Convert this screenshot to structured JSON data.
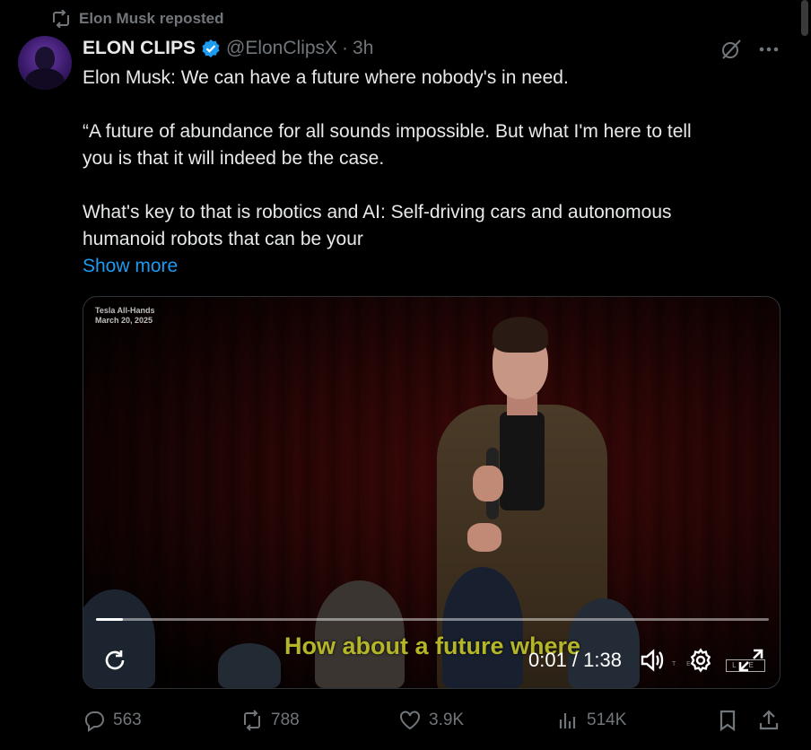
{
  "repost": {
    "label": "Elon Musk reposted",
    "icon": "repost-icon"
  },
  "author": {
    "name": "ELON CLIPS",
    "handle": "@ElonClipsX",
    "separator": "·",
    "time": "3h",
    "verified_color": "#1d9bf0"
  },
  "tweet": {
    "lines": [
      "Elon Musk: We can have a future where nobody's in need.",
      "",
      "“A future of abundance for all sounds impossible. But what I'm here to tell",
      "you is that it will indeed be the case.",
      "",
      "What's key to that is robotics and AI: Self-driving cars and autonomous",
      "humanoid robots that can be your"
    ],
    "show_more": "Show more"
  },
  "video": {
    "overlay_title": "Tesla All-Hands",
    "overlay_date": "March 20, 2025",
    "caption": "How about a future where",
    "time": "0:01 / 1:38",
    "progress": 0.01,
    "caption_color": "#b5b52a"
  },
  "actions": {
    "replies": "563",
    "reposts": "788",
    "likes": "3.9K",
    "views": "514K"
  },
  "colors": {
    "background": "#000000",
    "text": "#e7e9ea",
    "muted": "#71767b",
    "accent": "#1d9bf0"
  }
}
